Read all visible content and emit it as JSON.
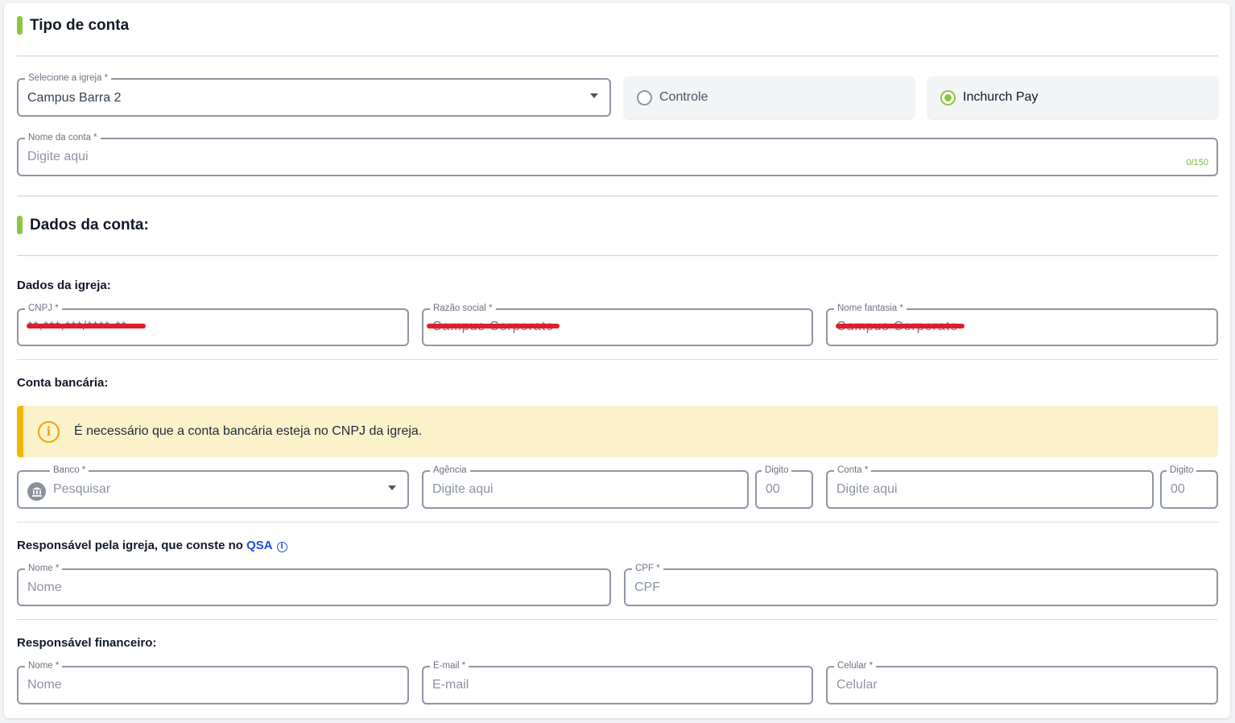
{
  "tipo_conta": {
    "title": "Tipo de conta",
    "igreja": {
      "label": "Selecione a igreja *",
      "value": "Campus Barra 2"
    },
    "options": [
      {
        "label": "Controle",
        "selected": false
      },
      {
        "label": "Inchurch Pay",
        "selected": true
      }
    ],
    "nome_conta": {
      "label": "Nome da conta *",
      "placeholder": "Digite aqui",
      "counter": "0/150"
    }
  },
  "dados_conta": {
    "title": "Dados da conta:",
    "dados_igreja": {
      "title": "Dados da igreja:",
      "cnpj": {
        "label": "CNPJ *",
        "value": "**.***.***/****-**"
      },
      "razao_social": {
        "label": "Razão social *",
        "value": "Campus Corporate"
      },
      "nome_fantasia": {
        "label": "Nome fantasia *",
        "value": "Campus Corporate"
      }
    },
    "conta_bancaria": {
      "title": "Conta bancária:",
      "alert": "É necessário que a conta bancária esteja no CNPJ da igreja.",
      "banco": {
        "label": "Banco *",
        "placeholder": "Pesquisar"
      },
      "agencia": {
        "label": "Agência",
        "placeholder": "Digite aqui"
      },
      "agencia_digito": {
        "label": "Digito",
        "placeholder": "00"
      },
      "conta": {
        "label": "Conta *",
        "placeholder": "Digite aqui"
      },
      "conta_digito": {
        "label": "Digito",
        "placeholder": "00"
      }
    },
    "responsavel_igreja": {
      "title": "Responsável pela igreja, que conste no",
      "link": "QSA",
      "nome": {
        "label": "Nome *",
        "placeholder": "Nome"
      },
      "cpf": {
        "label": "CPF *",
        "placeholder": "CPF"
      }
    },
    "responsavel_financeiro": {
      "title": "Responsável financeiro:",
      "nome": {
        "label": "Nome *",
        "placeholder": "Nome"
      },
      "email": {
        "label": "E-mail *",
        "placeholder": "E-mail"
      },
      "celular": {
        "label": "Celular *",
        "placeholder": "Celular"
      }
    }
  },
  "colors": {
    "accent": "#8cc63f",
    "alert_bg": "#fbf2cc",
    "alert_border": "#f2b705",
    "link": "#1d4ed8",
    "redaction": "#e11d2a"
  },
  "icons": [
    "caret-down-icon",
    "warning-info-icon",
    "bank-icon",
    "info-icon"
  ]
}
